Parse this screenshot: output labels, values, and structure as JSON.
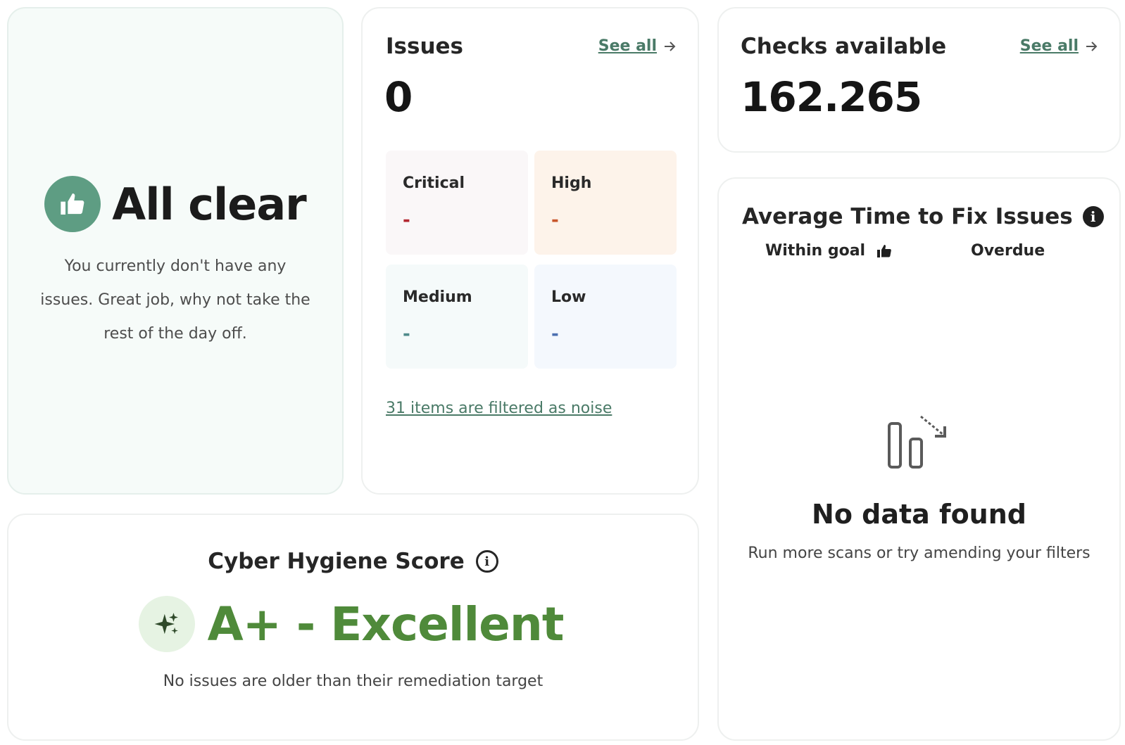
{
  "all_clear": {
    "title": "All clear",
    "message": "You currently don't have any issues. Great job, why not take the rest of the day off.",
    "icon": "thumbs-up-icon"
  },
  "issues": {
    "title": "Issues",
    "see_all": "See all",
    "count": "0",
    "severities": [
      {
        "label": "Critical",
        "value": "-",
        "bg": "#faf7f8",
        "color": "#b3262f"
      },
      {
        "label": "High",
        "value": "-",
        "bg": "#fdf3ea",
        "color": "#c8552b"
      },
      {
        "label": "Medium",
        "value": "-",
        "bg": "#f5fafa",
        "color": "#4e8a8a"
      },
      {
        "label": "Low",
        "value": "-",
        "bg": "#f4f8fd",
        "color": "#4b6fb0"
      }
    ],
    "noise_link": "31 items are filtered as noise"
  },
  "checks": {
    "title": "Checks available",
    "see_all": "See all",
    "count": "162.265"
  },
  "avg_time": {
    "title": "Average Time to Fix Issues",
    "legend_within": "Within goal",
    "legend_overdue": "Overdue",
    "empty_title": "No data found",
    "empty_text": "Run more scans or try amending your filters"
  },
  "hygiene": {
    "title": "Cyber Hygiene Score",
    "score": "A+ - Excellent",
    "text": "No issues are older than their remediation target"
  },
  "colors": {
    "accent": "#5e9d83",
    "link": "#4a7a67",
    "score": "#4f8a3a"
  }
}
